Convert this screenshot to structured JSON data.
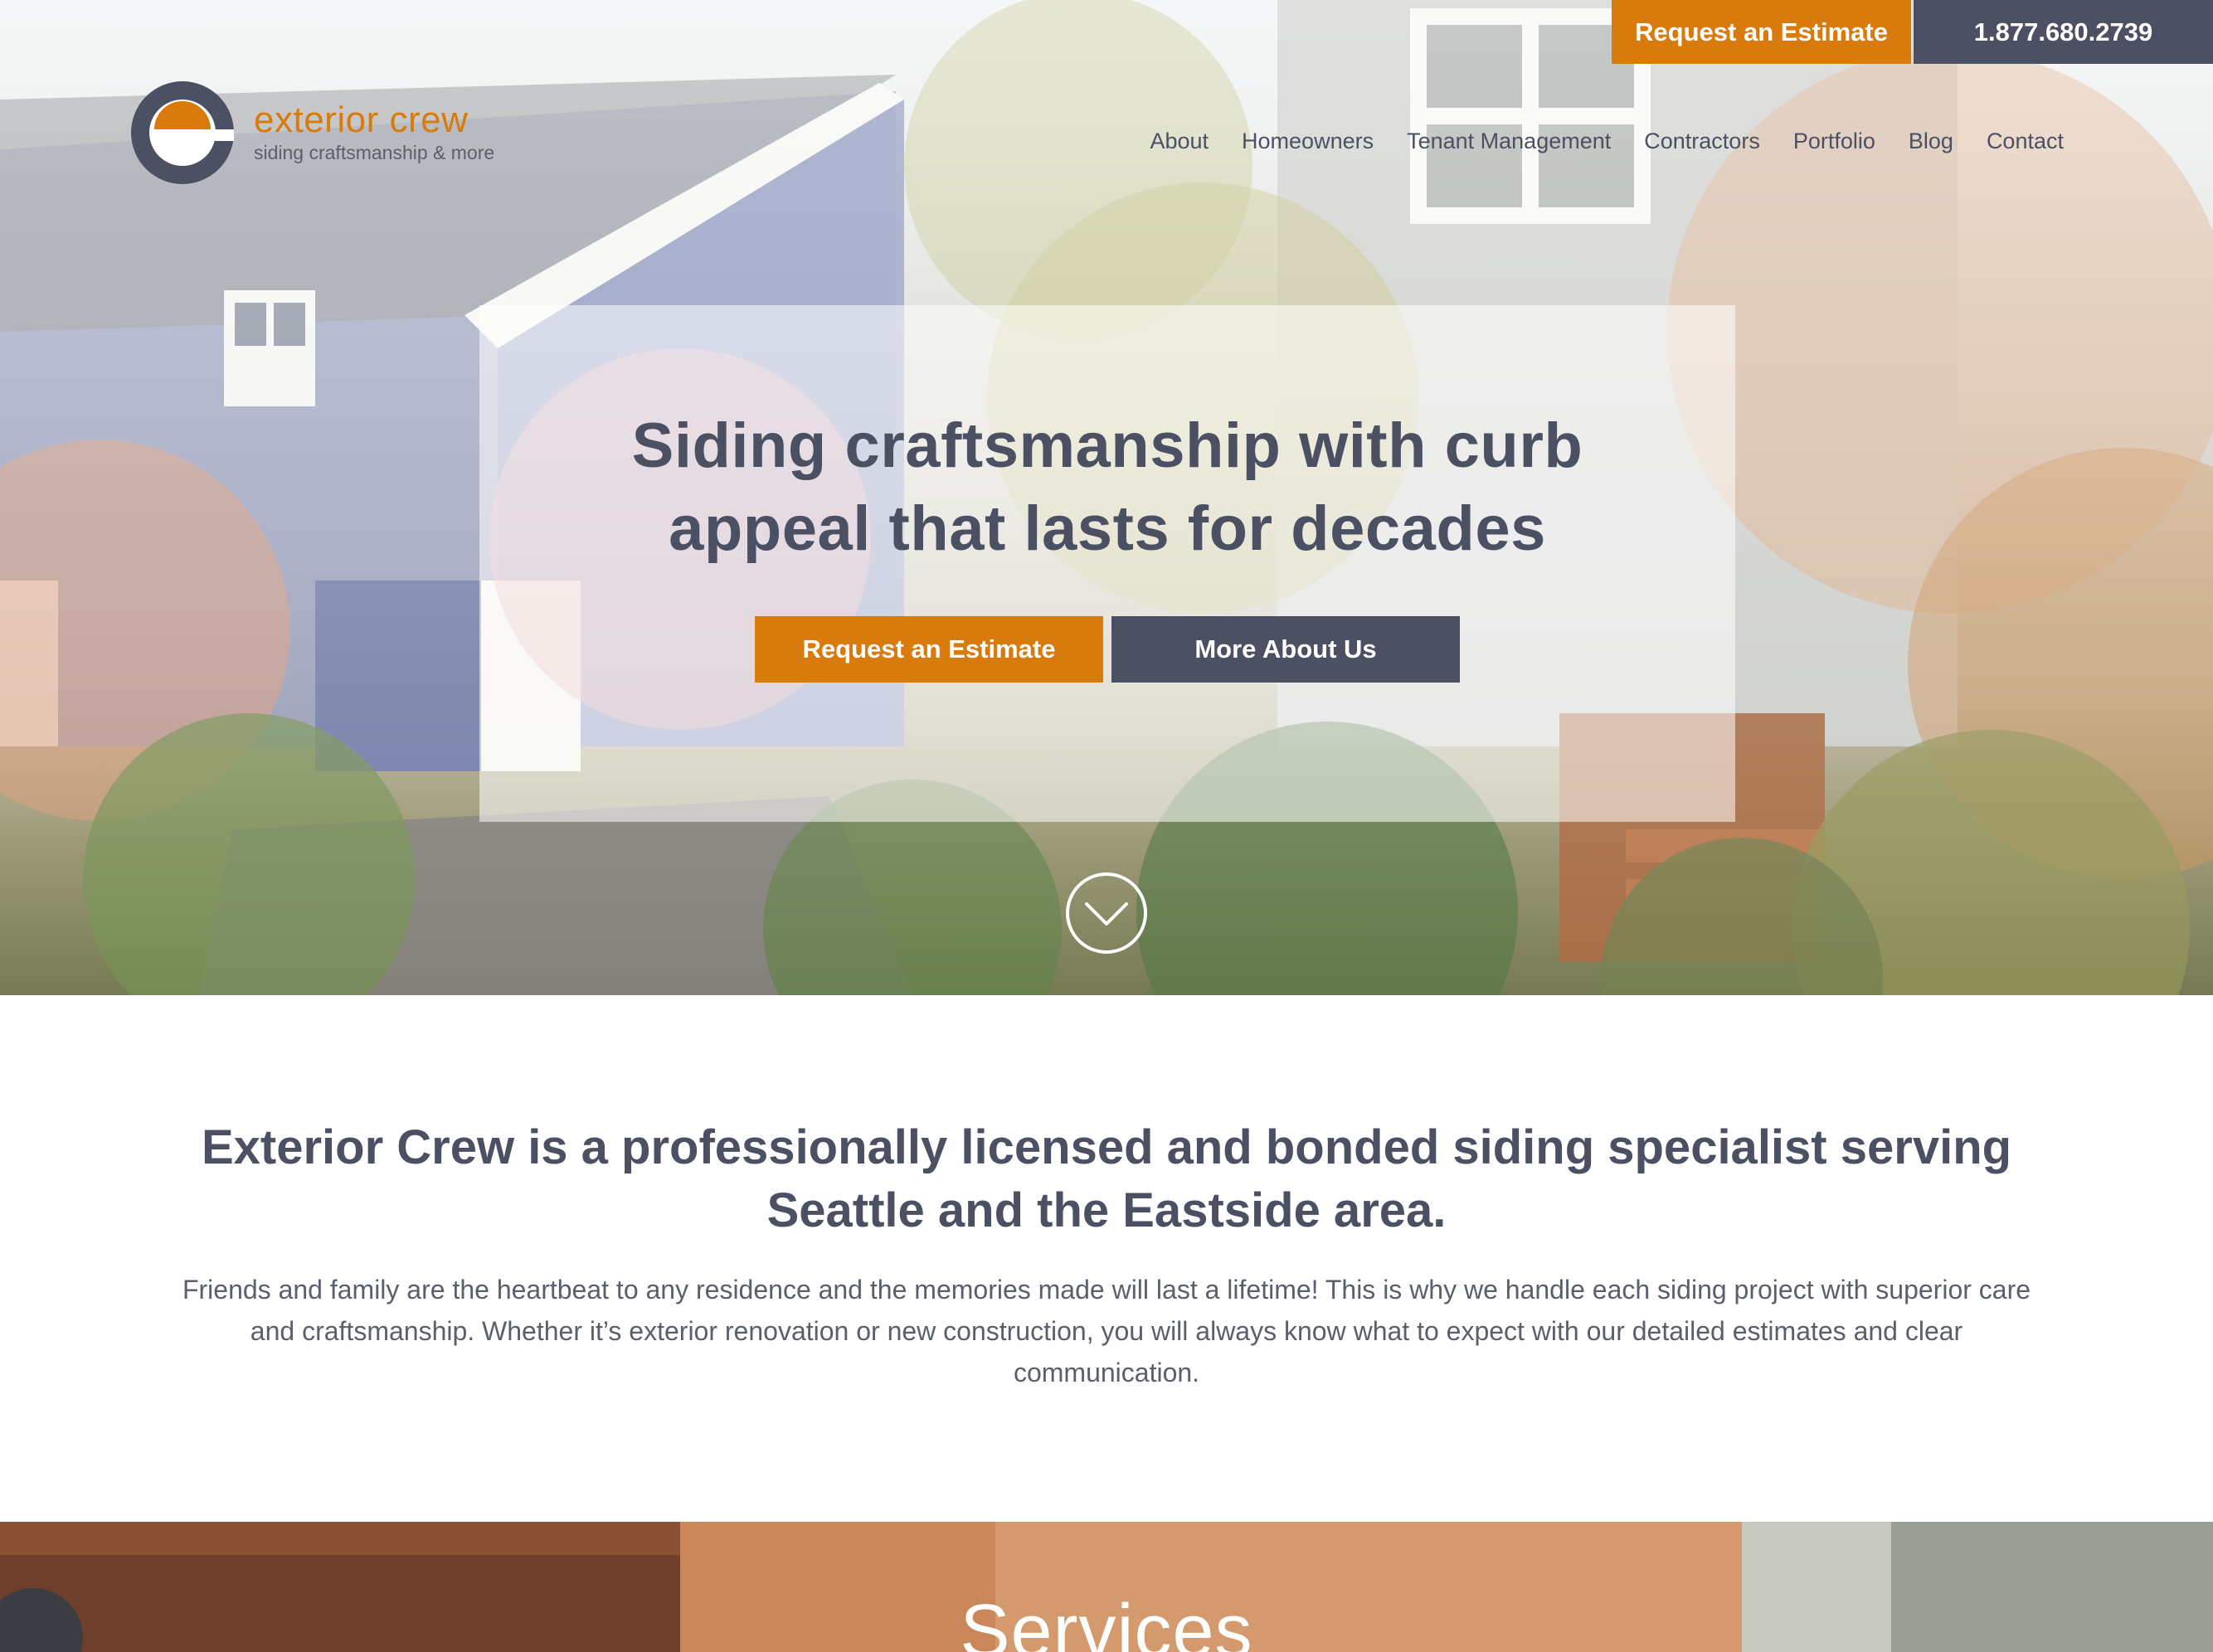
{
  "topbar": {
    "estimate_label": "Request an Estimate",
    "phone": "1.877.680.2739"
  },
  "logo": {
    "name": "exterior crew",
    "tagline": "siding craftsmanship & more"
  },
  "nav": {
    "items": [
      {
        "label": "About"
      },
      {
        "label": "Homeowners"
      },
      {
        "label": "Tenant Management"
      },
      {
        "label": "Contractors"
      },
      {
        "label": "Portfolio"
      },
      {
        "label": "Blog"
      },
      {
        "label": "Contact"
      }
    ]
  },
  "hero": {
    "title_line1": "Siding craftsmanship with curb",
    "title_line2": "appeal that lasts for decades",
    "primary_button": "Request an Estimate",
    "secondary_button": "More About Us",
    "scroll_icon": "chevron-down-circle-icon"
  },
  "intro": {
    "heading_line1": "Exterior Crew is a professionally licensed and bonded siding specialist serving",
    "heading_line2": "Seattle and the Eastside area.",
    "body_line1": "Friends and family are the heartbeat to any residence and the memories made will last a lifetime! This is why we handle each siding project with superior care",
    "body_line2": "and craftsmanship. Whether it’s exterior renovation or new construction, you will always know what to expect with our detailed estimates and clear",
    "body_line3": "communication."
  },
  "services": {
    "title": "Services"
  },
  "colors": {
    "accent_orange": "#d97a0c",
    "slate": "#4b5062",
    "white": "#ffffff"
  }
}
